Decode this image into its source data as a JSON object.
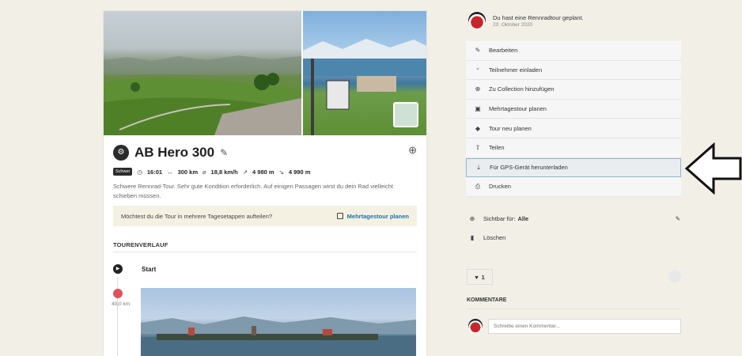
{
  "tour": {
    "title": "AB Hero 300",
    "level": "Schwer",
    "duration": "16:01",
    "distance": "300 km",
    "speed": "18,8 km/h",
    "uphill": "4 980 m",
    "downhill": "4 990 m",
    "description": "Schwere Rennrad-Tour. Sehr gute Kondition erforderlich. Auf einigen Passagen wirst du dein Rad vielleicht schieben müssen.",
    "split_question": "Möchtest du die Tour in mehrere Tagesetappen aufteilen?",
    "split_button": "Mehrtagestour planen",
    "section_title": "TOURENVERLAUF",
    "start_label": "Start",
    "waypoint_distance": "40,0 km"
  },
  "side": {
    "title": "Du hast eine Rennradtour geplant.",
    "date": "20. Oktober 2020",
    "menu": [
      {
        "label": "Bearbeiten",
        "icon": "✎"
      },
      {
        "label": "Teilnehmer einladen",
        "icon": "⁺"
      },
      {
        "label": "Zu Collection hinzufügen",
        "icon": "⊕"
      },
      {
        "label": "Mehrtagestour planen",
        "icon": "▣"
      },
      {
        "label": "Tour neu planen",
        "icon": "◆"
      },
      {
        "label": "Teilen",
        "icon": "⇧"
      },
      {
        "label": "Für GPS-Gerät herunterladen",
        "icon": "⤓"
      },
      {
        "label": "Drucken",
        "icon": "⎙"
      }
    ],
    "visibility_label": "Sichtbar für:",
    "visibility_value": "Alle",
    "delete_label": "Löschen",
    "likes": "1",
    "comments_title": "KOMMENTARE",
    "comment_placeholder": "Schreibe einen Kommentar..."
  },
  "colors": {
    "accent": "#1f6fab",
    "highlight": "#8fb5d3"
  }
}
